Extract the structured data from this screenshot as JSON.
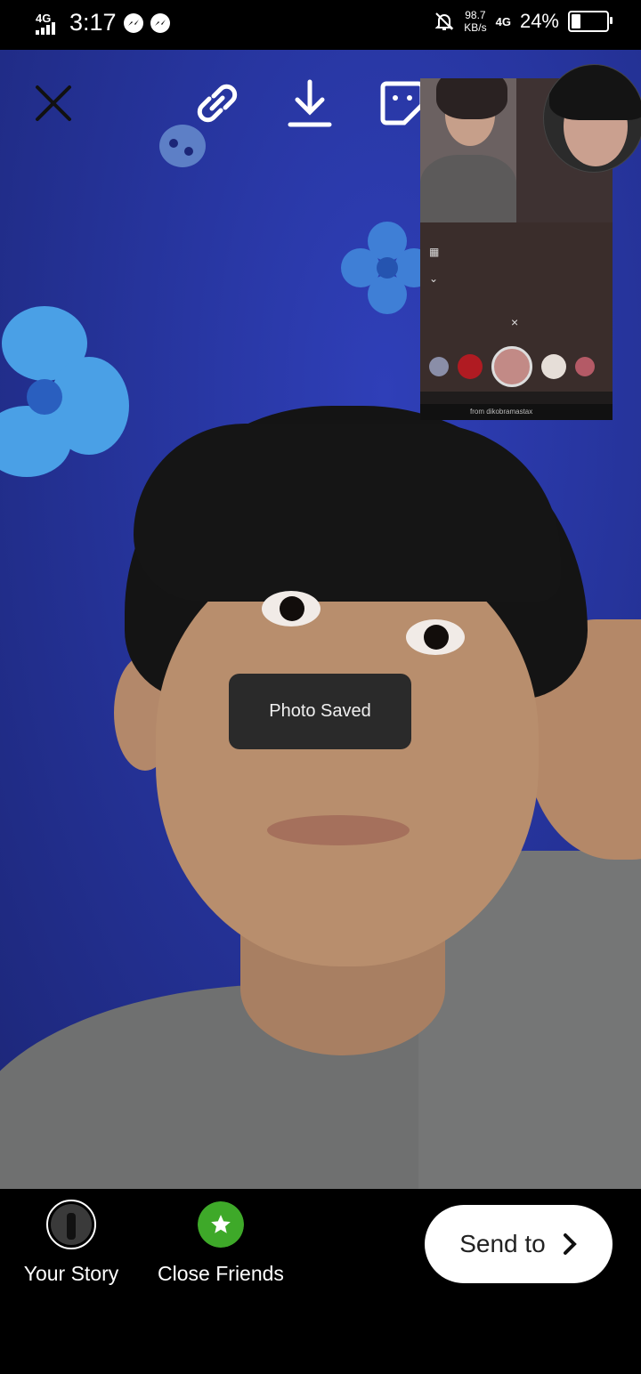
{
  "status_bar": {
    "network_left": "4G",
    "time": "3:17",
    "speed_value": "98.7",
    "speed_unit": "KB/s",
    "network_right": "4G",
    "battery_percent": "24%",
    "battery_level": 0.24,
    "icons": [
      "signal-icon",
      "messenger-icon",
      "messenger-icon",
      "mute-bell-icon",
      "battery-icon"
    ]
  },
  "toolbar": {
    "icons": [
      "close-icon",
      "link-icon",
      "download-icon",
      "sticker-icon"
    ]
  },
  "inset_screenshot": {
    "caption": "from dikobramastax"
  },
  "toast": {
    "text": "Photo Saved"
  },
  "bottom": {
    "your_story_label": "Your Story",
    "close_friends_label": "Close Friends",
    "send_to_label": "Send to",
    "accent_green": "#3ea929"
  }
}
